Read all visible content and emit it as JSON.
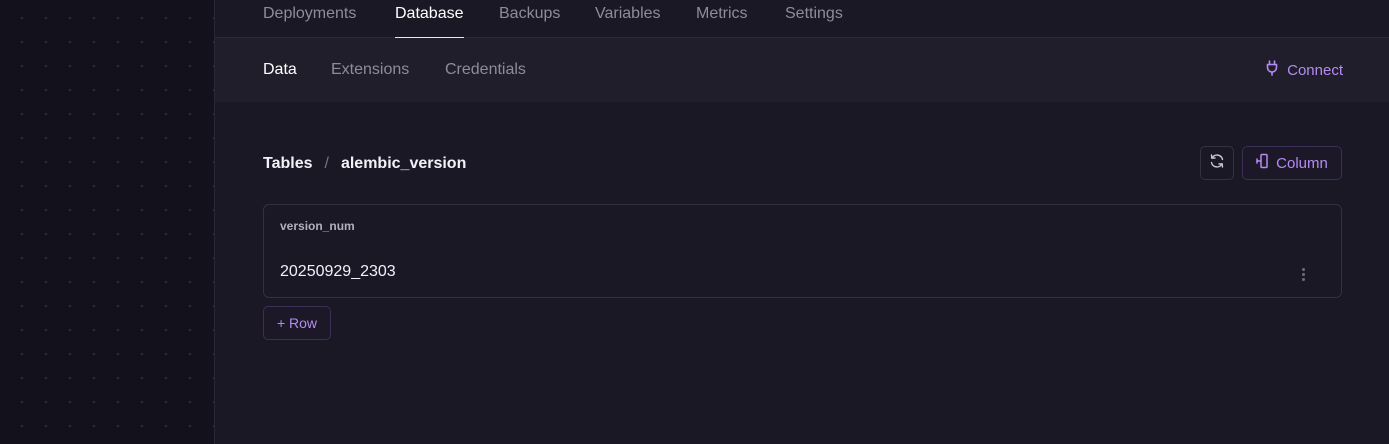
{
  "top_tabs": [
    {
      "label": "Deployments"
    },
    {
      "label": "Database"
    },
    {
      "label": "Backups"
    },
    {
      "label": "Variables"
    },
    {
      "label": "Metrics"
    },
    {
      "label": "Settings"
    }
  ],
  "active_top_tab": "Database",
  "sub_tabs": [
    {
      "label": "Data"
    },
    {
      "label": "Extensions"
    },
    {
      "label": "Credentials"
    }
  ],
  "active_sub_tab": "Data",
  "connect": {
    "label": "Connect",
    "icon": "plug-icon"
  },
  "breadcrumb": {
    "root": "Tables",
    "separator": "/",
    "current": "alembic_version"
  },
  "toolbar": {
    "refresh_icon": "refresh-icon",
    "column_label": "Column",
    "column_icon": "column-insert-icon"
  },
  "table": {
    "columns": [
      "version_num"
    ],
    "rows": [
      [
        "20250929_2303"
      ]
    ],
    "row_menu_icon": "kebab-menu-icon"
  },
  "add_row_label": "+ Row",
  "colors": {
    "accent": "#b58bf2",
    "background": "#1a1824",
    "canvas": "#13111c"
  }
}
